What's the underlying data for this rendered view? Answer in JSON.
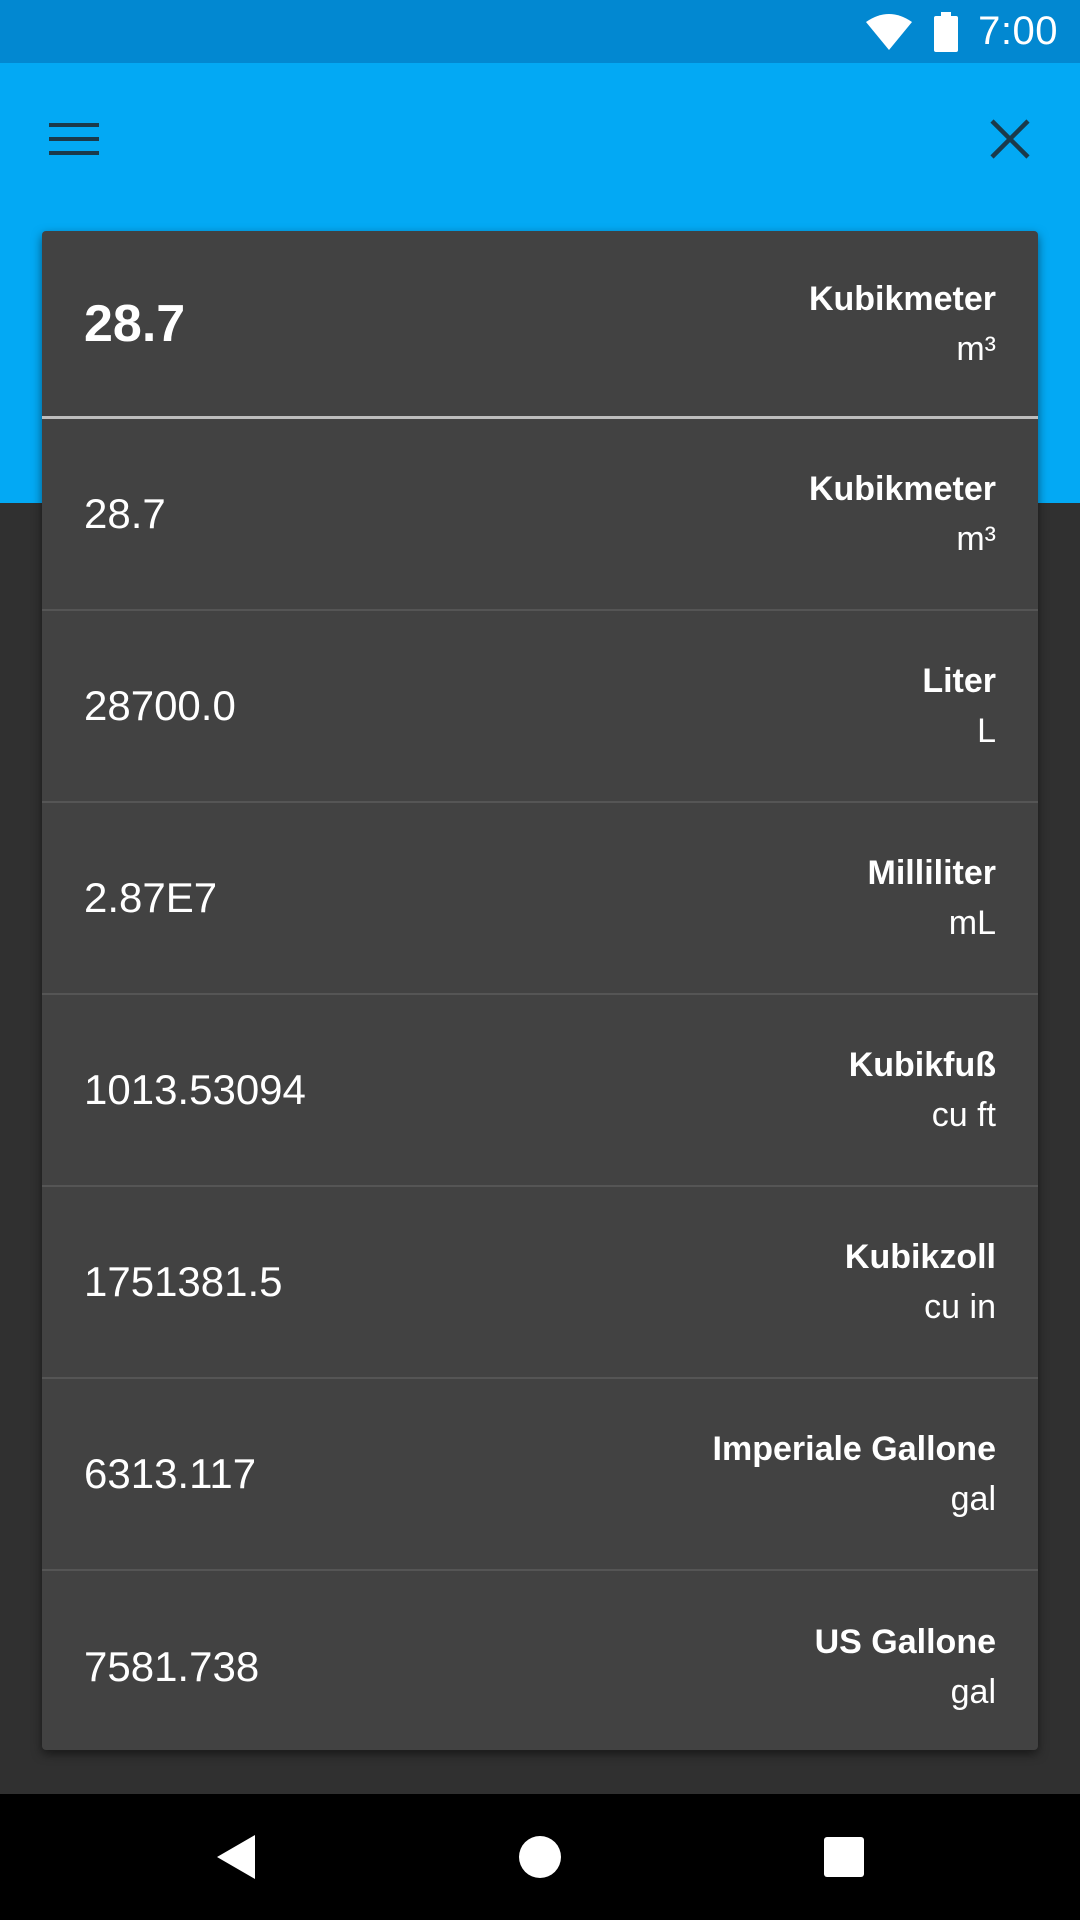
{
  "status_bar": {
    "time": "7:00",
    "icons": [
      "wifi-icon",
      "battery-icon"
    ]
  },
  "app_bar": {
    "color": "#03A9F4",
    "left_icon": "menu-icon",
    "right_icon": "close-icon"
  },
  "input": {
    "value": "28.7",
    "unit_name": "Kubikmeter",
    "unit_symbol": "m³"
  },
  "results": [
    {
      "value": "28.7",
      "unit_name": "Kubikmeter",
      "unit_symbol": "m³"
    },
    {
      "value": "28700.0",
      "unit_name": "Liter",
      "unit_symbol": "L"
    },
    {
      "value": "2.87E7",
      "unit_name": "Milliliter",
      "unit_symbol": "mL"
    },
    {
      "value": "1013.53094",
      "unit_name": "Kubikfuß",
      "unit_symbol": "cu ft"
    },
    {
      "value": "1751381.5",
      "unit_name": "Kubikzoll",
      "unit_symbol": "cu in"
    },
    {
      "value": "6313.117",
      "unit_name": "Imperiale Gallone",
      "unit_symbol": "gal"
    },
    {
      "value": "7581.738",
      "unit_name": "US Gallone",
      "unit_symbol": "gal"
    }
  ],
  "nav_bar": {
    "icons": [
      "back-icon",
      "home-icon",
      "recents-icon"
    ]
  }
}
